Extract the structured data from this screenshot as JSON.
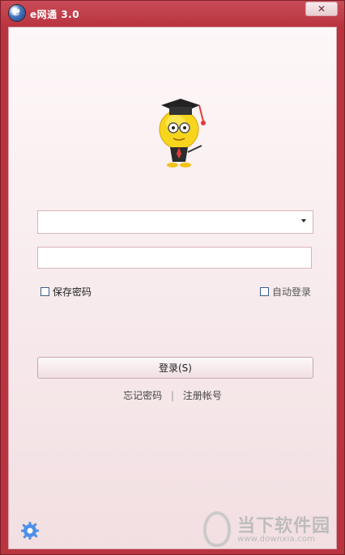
{
  "window": {
    "title": "e网通 3.0",
    "logo_letter": "e",
    "close_label": "✕"
  },
  "login_form": {
    "account_value": "",
    "password_value": "",
    "save_password_label": "保存密码",
    "auto_login_label": "自动登录",
    "login_button_label": "登录(S)",
    "forgot_password_label": "忘记密码",
    "separator": "|",
    "register_label": "注册帐号"
  },
  "icons": {
    "mascot": "graduate-smiley-icon",
    "settings": "gear-icon",
    "dropdown": "chevron-down-icon"
  },
  "watermark": {
    "cn_text": "当下软件园",
    "url_text": "www.downxia.com"
  },
  "colors": {
    "frame": "#b9343f",
    "panel_top": "#fdf7f8",
    "panel_bottom": "#f2dfe2",
    "settings_blue": "#4f8fe8"
  }
}
